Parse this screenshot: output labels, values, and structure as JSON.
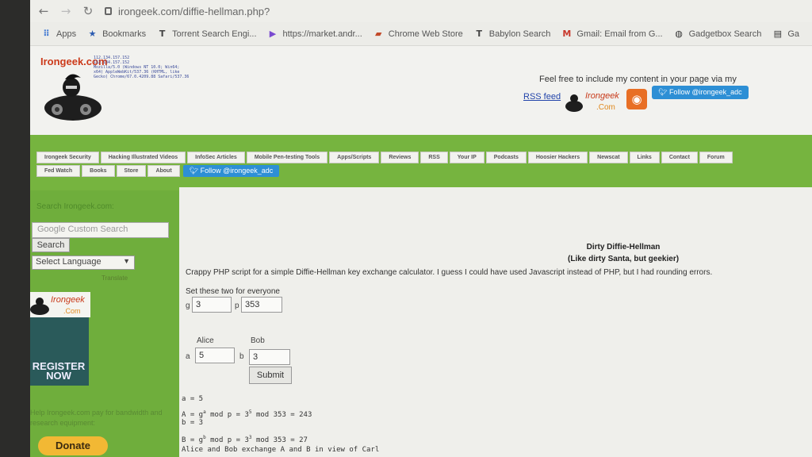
{
  "browser": {
    "url": "irongeek.com/diffie-hellman.php?",
    "bookmarks": [
      {
        "label": "Apps",
        "icon": "apps-grid-icon"
      },
      {
        "label": "Bookmarks",
        "icon": "star-icon"
      },
      {
        "label": "Torrent Search Engi...",
        "icon": "t-logo-icon"
      },
      {
        "label": "https://market.andr...",
        "icon": "play-store-icon"
      },
      {
        "label": "Chrome Web Store",
        "icon": "chrome-store-icon"
      },
      {
        "label": "Babylon Search",
        "icon": "t-logo-icon"
      },
      {
        "label": "Gmail: Email from G...",
        "icon": "gmail-icon"
      },
      {
        "label": "Gadgetbox Search",
        "icon": "globe-icon"
      },
      {
        "label": "Ga",
        "icon": "folder-icon"
      }
    ]
  },
  "header": {
    "site_name": "Irongeek.com",
    "ip_lines": [
      "112.134.157.152",
      "112.134.157.152",
      "Mozilla/5.0 (Windows NT 10.0; Win64;",
      "x64) AppleWebKit/537.36 (KHTML, like",
      "Gecko) Chrome/67.0.4209.88 Safari/537.36"
    ],
    "include_text": "Feel free to include my content in your page via my",
    "rss_feed": "RSS feed",
    "logo_small_text": "Irongeek",
    "logo_small_com": ".Com",
    "follow_label": "Follow @irongeek_adc"
  },
  "nav": {
    "row1": [
      "Irongeek Security",
      "Hacking Illustrated Videos",
      "InfoSec Articles",
      "Mobile Pen-testing Tools",
      "Apps/Scripts",
      "Reviews",
      "RSS",
      "Your IP",
      "Podcasts",
      "Hoosier Hackers",
      "Newscat",
      "Links",
      "Contact",
      "Forum"
    ],
    "row2": [
      "Fed Watch",
      "Books",
      "Store",
      "About"
    ],
    "follow_label": "Follow @irongeek_adc"
  },
  "sidebar": {
    "site_search": "Search Irongeek.com:",
    "search_placeholder": "Google Custom Search",
    "search_button": "Search",
    "language_select": "Select Language",
    "translate": "Translate",
    "register_now": "REGISTER NOW",
    "pay_text": "Help Irongeek.com pay for bandwidth and research equipment:",
    "donate": "Donate"
  },
  "main": {
    "title": "Dirty Diffie-Hellman",
    "subtitle": "(Like dirty Santa, but geekier)",
    "description": "Crappy PHP script for a simple Diffie-Hellman key exchange calculator. I guess I could have used Javascript instead of PHP, but I had rounding errors.",
    "set_label": "Set these two for everyone",
    "g_label": "g",
    "g_value": "3",
    "p_label": "p",
    "p_value": "353",
    "alice_label": "Alice",
    "bob_label": "Bob",
    "a_label": "a",
    "a_value": "5",
    "b_label": "b",
    "b_value": "3",
    "submit": "Submit",
    "calc": {
      "line1": "a = 5",
      "line2_prefix": "A = g",
      "line2_exp": "a",
      "line2_mid": " mod p = 3",
      "line2_exp2": "5",
      "line2_suffix": " mod 353 = 243",
      "line3": "b = 3",
      "line4_prefix": "B = g",
      "line4_exp": "b",
      "line4_mid": " mod p = 3",
      "line4_exp2": "3",
      "line4_suffix": " mod 353 = 27",
      "line5": "Alice and Bob exchange A and B in view of Carl"
    }
  }
}
